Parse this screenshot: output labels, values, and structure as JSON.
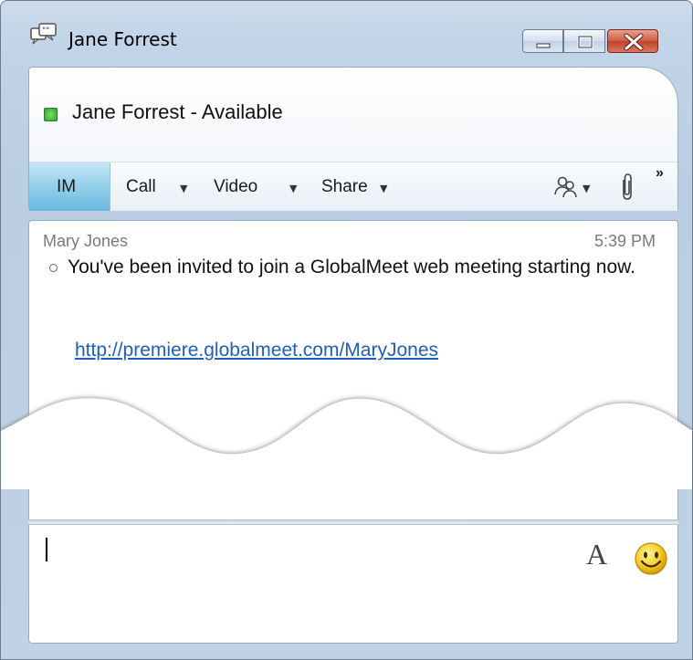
{
  "window": {
    "title": "Jane Forrest",
    "icons": {
      "app": "im-chat-icon",
      "minimize": "minimize-icon",
      "maximize": "maximize-icon",
      "close": "close-icon"
    }
  },
  "contact": {
    "name_status": "Jane Forrest - Available",
    "presence_color": "#3cb43c",
    "presence_icon": "presence-available-icon"
  },
  "toolbar": {
    "im_label": "IM",
    "call_label": "Call",
    "video_label": "Video",
    "share_label": "Share",
    "icons": [
      "people-options-icon",
      "paperclip-icon",
      "more-chevron-icon"
    ]
  },
  "conversation": {
    "sender": "Mary Jones",
    "time": "5:39 PM",
    "message": "You've been invited to join a GlobalMeet web meeting starting now.",
    "link": "http://premiere.globalmeet.com/MaryJones"
  },
  "compose": {
    "value": "",
    "font_button": "A",
    "emoticon_icon": "smiley-icon"
  },
  "colors": {
    "accent": "#8ecde9",
    "link": "#1f5fb9"
  }
}
